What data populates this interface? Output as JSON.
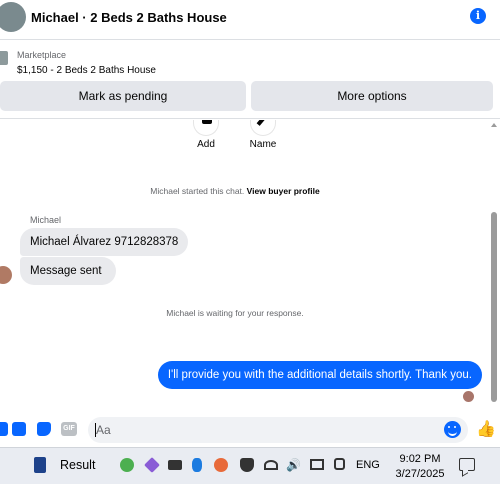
{
  "header": {
    "title": "Michael · 2 Beds 2 Baths House",
    "info_icon": "info-icon",
    "info_glyph": "i"
  },
  "listing": {
    "source": "Marketplace",
    "item": "$1,150 - 2 Beds 2 Baths House",
    "mark_pending_label": "Mark as pending",
    "more_options_label": "More options"
  },
  "quick_actions": {
    "add_label": "Add",
    "name_label": "Name"
  },
  "conversation": {
    "started_text": "Michael started this chat.",
    "view_profile_label": "View buyer profile",
    "sender_name": "Michael",
    "incoming": [
      "Michael Álvarez 9712828378",
      "Message sent"
    ],
    "waiting_text": "Michael is waiting for your response.",
    "outgoing": "I'll provide you with the additional details shortly. Thank you."
  },
  "composer": {
    "placeholder": "Aa",
    "gif_label": "GIF",
    "like_glyph": "👍"
  },
  "taskbar": {
    "result_label": "Result",
    "volume_glyph": "🔊",
    "language": "ENG",
    "time": "9:02 PM",
    "date": "3/27/2025"
  },
  "colors": {
    "accent": "#0866ff",
    "incoming_bubble": "#e9eaed",
    "button_bg": "#e4e6eb",
    "taskbar_bg": "#e9ecf2"
  }
}
